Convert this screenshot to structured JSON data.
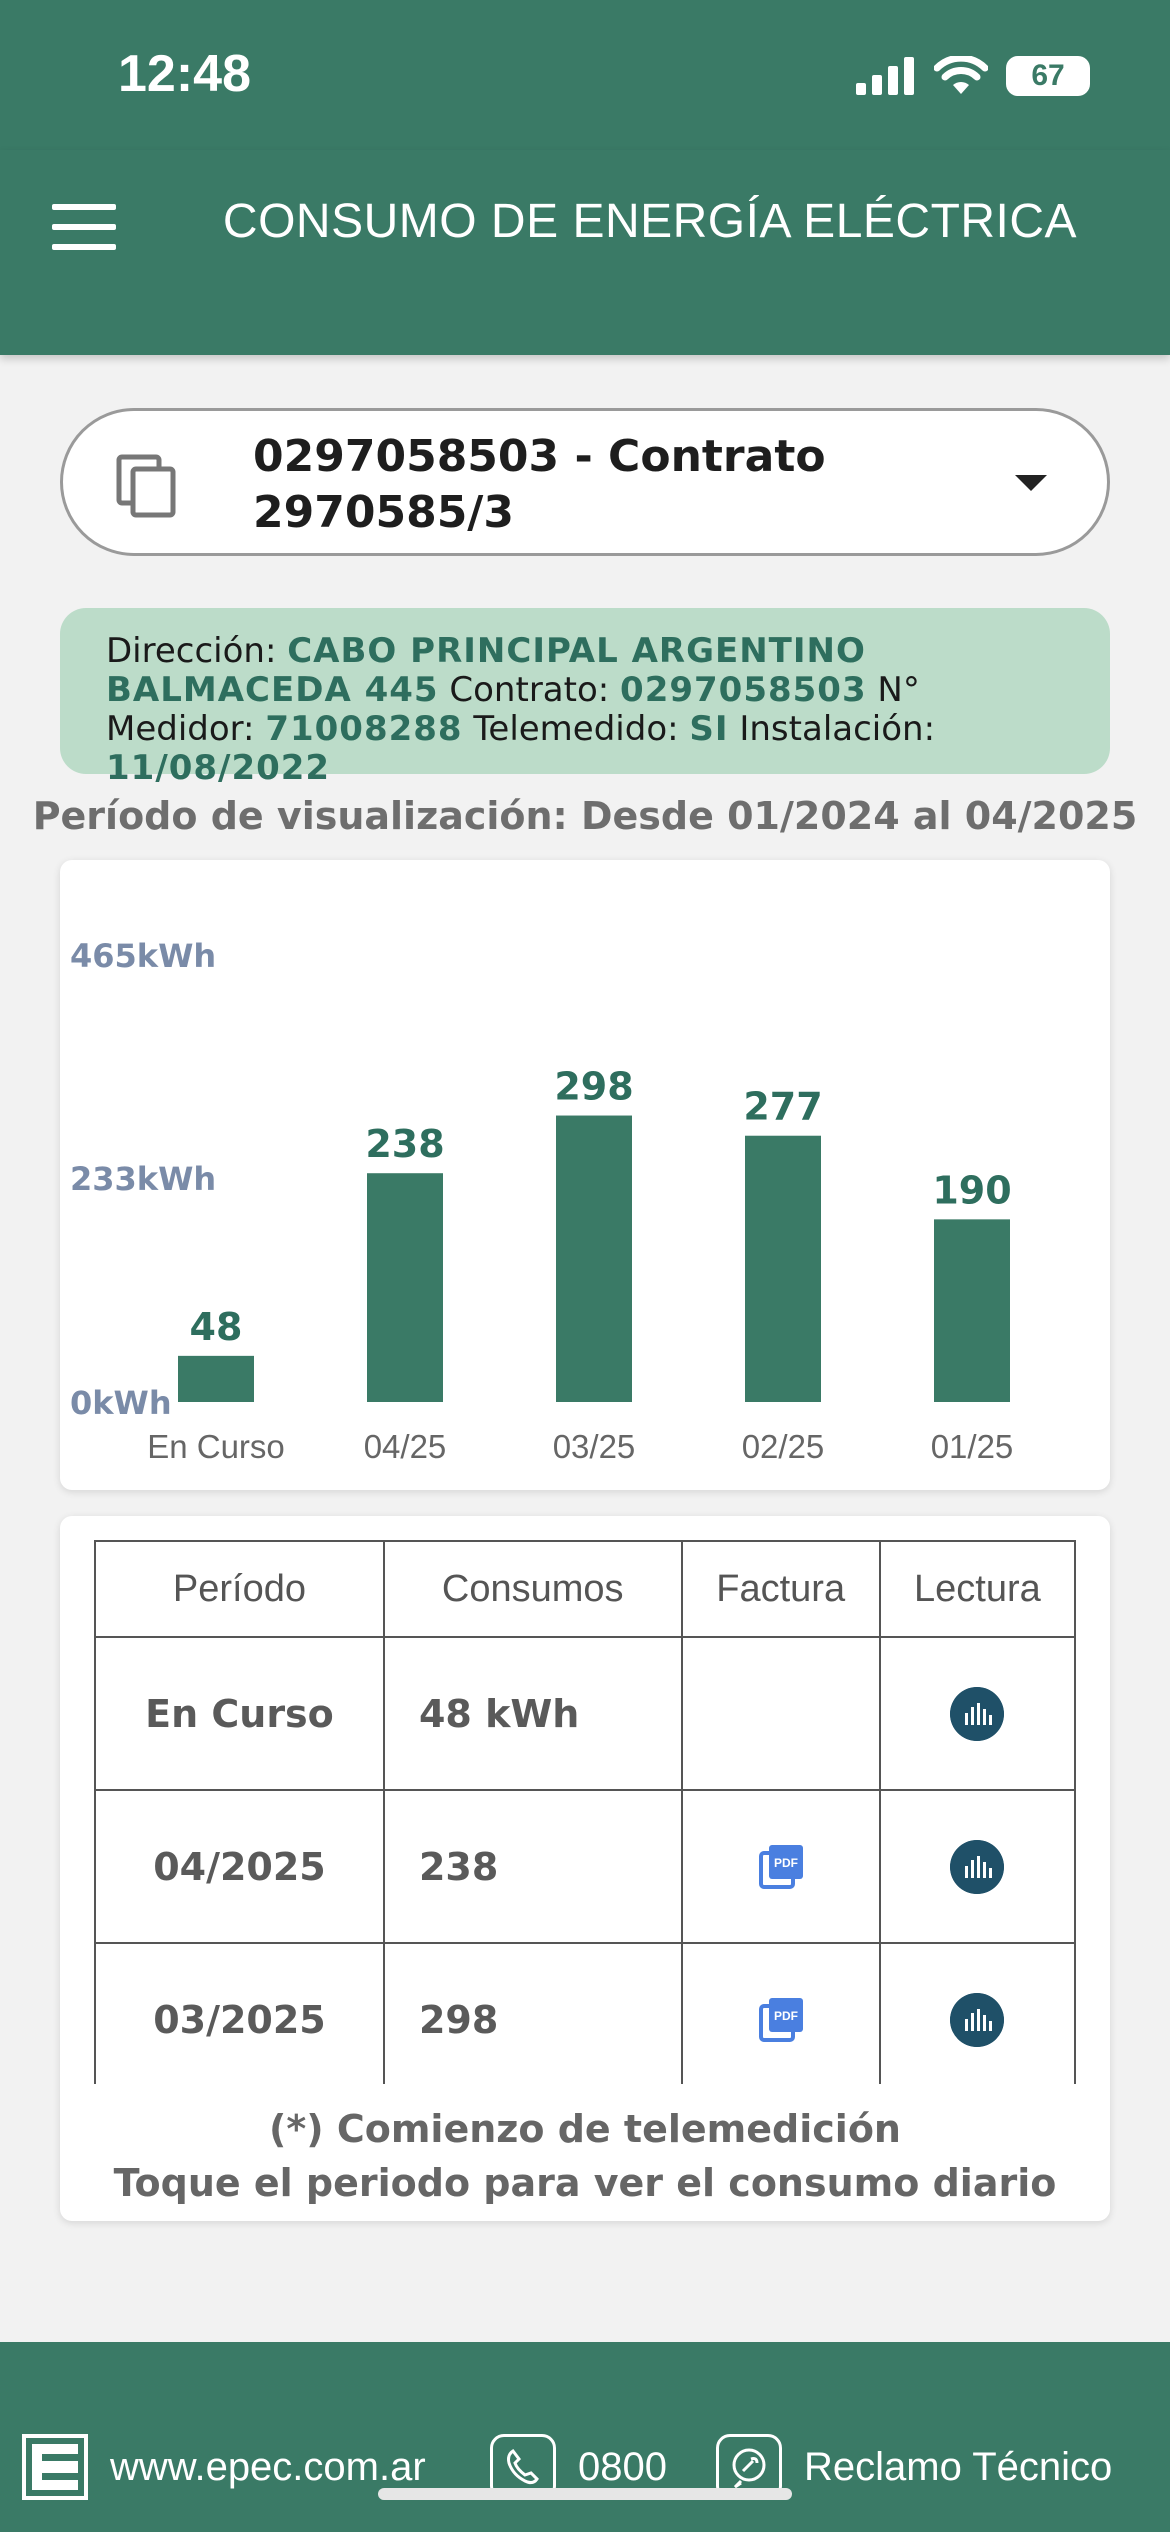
{
  "status": {
    "time": "12:48",
    "battery": "67"
  },
  "header": {
    "title": "CONSUMO DE ENERGÍA ELÉCTRICA"
  },
  "contract_select": {
    "line1": "0297058503 - Contrato",
    "line2": "2970585/3"
  },
  "info": {
    "direccion_label": "Dirección:",
    "direccion_value": "CABO PRINCIPAL ARGENTINO BALMACEDA 445",
    "contrato_label": "Contrato:",
    "contrato_value": "0297058503",
    "medidor_label": "N° Medidor:",
    "medidor_value": "71008288",
    "telemedido_label": "Telemedido:",
    "telemedido_value": "SI",
    "instalacion_label": "Instalación:",
    "instalacion_value": "11/08/2022"
  },
  "period_label": "Período de visualización: Desde 01/2024 al 04/2025",
  "chart_data": {
    "type": "bar",
    "categories": [
      "En Curso",
      "04/25",
      "03/25",
      "02/25",
      "01/25"
    ],
    "values": [
      48,
      238,
      298,
      277,
      190
    ],
    "data_labels": [
      "48",
      "238",
      "298",
      "277",
      "190"
    ],
    "y_ticks": [
      "465kWh",
      "233kWh",
      "0kWh"
    ],
    "y_tick_values": [
      465,
      233,
      0
    ],
    "ylim": [
      0,
      465
    ],
    "bar_color": "#3a7a66",
    "label_color": "#2e6e5e",
    "tick_color": "#7a8ba8",
    "grid": false,
    "title": "",
    "xlabel": "",
    "ylabel": ""
  },
  "table": {
    "headers": [
      "Período",
      "Consumos",
      "Factura",
      "Lectura"
    ],
    "rows": [
      {
        "period": "En Curso",
        "consumo": "48 kWh",
        "factura": false
      },
      {
        "period": "04/2025",
        "consumo": "238",
        "factura": true
      },
      {
        "period": "03/2025",
        "consumo": "298",
        "factura": true
      }
    ],
    "icons": {
      "factura": "pdf-icon",
      "lectura": "bar-chart-icon"
    }
  },
  "notes": {
    "line1": "(*) Comienzo de telemedición",
    "line2": "Toque el periodo para ver el consumo diario"
  },
  "footer": {
    "website": "www.epec.com.ar",
    "phone": "0800",
    "reclamo": "Reclamo Técnico"
  },
  "colors": {
    "primary": "#3a7a66",
    "info_bg": "#bcdcc9",
    "lectura_icon": "#1f5068",
    "pdf_icon": "#4a7fe0"
  }
}
